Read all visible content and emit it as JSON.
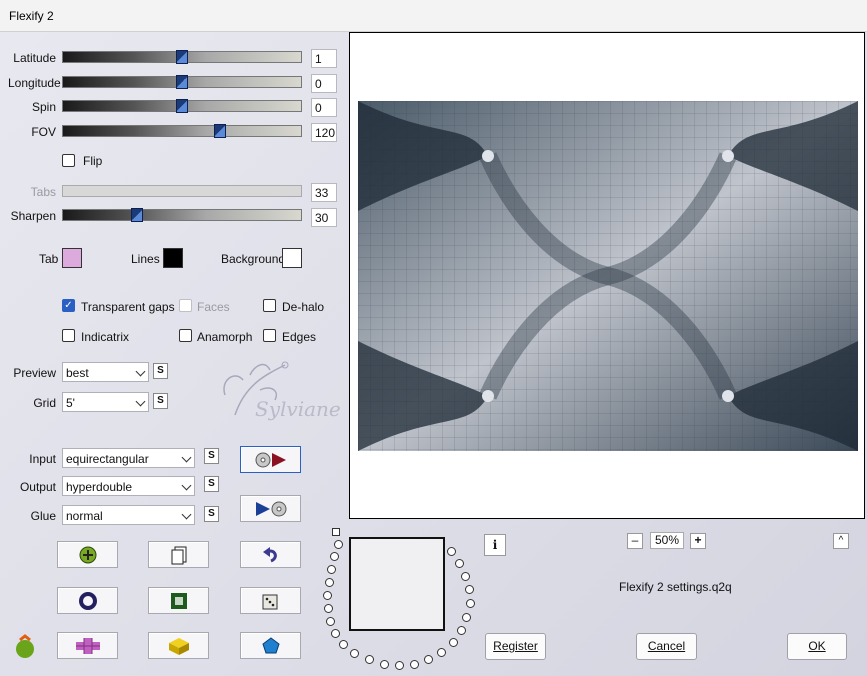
{
  "window": {
    "title": "Flexify 2"
  },
  "sliders": [
    {
      "label": "Latitude",
      "value": "1",
      "level": 0.5
    },
    {
      "label": "Longitude",
      "value": "0",
      "level": 0.5
    },
    {
      "label": "Spin",
      "value": "0",
      "level": 0.5
    },
    {
      "label": "FOV",
      "value": "120",
      "level": 0.66
    },
    {
      "label": "Tabs",
      "value": "33",
      "level": null,
      "disabled": true
    },
    {
      "label": "Sharpen",
      "value": "30",
      "level": 0.31
    }
  ],
  "flip": {
    "label": "Flip",
    "checked": false
  },
  "colors": {
    "tab_label": "Tab",
    "tab_color": "#dcaadc",
    "lines_label": "Lines",
    "lines_color": "#000000",
    "background_label": "Background",
    "background_color": "#ffffff"
  },
  "options": {
    "transparent_gaps": "Transparent gaps",
    "faces": "Faces",
    "de_halo": "De-halo",
    "indicatrix": "Indicatrix",
    "anamorph": "Anamorph",
    "edges": "Edges"
  },
  "selects": {
    "preview_label": "Preview",
    "preview_value": "best",
    "grid_label": "Grid",
    "grid_value": "5'",
    "input_label": "Input",
    "input_value": "equirectangular",
    "output_label": "Output",
    "output_value": "hyperdouble",
    "glue_label": "Glue",
    "glue_value": "normal",
    "s": "S"
  },
  "watermark": "Sylviane",
  "zoom": {
    "minus": "–",
    "value": "50%",
    "plus": "+"
  },
  "settings_file": "Flexify 2 settings.q2q",
  "buttons": {
    "info": "i",
    "collapse": "^",
    "register": "Register",
    "cancel": "Cancel",
    "ok": "OK"
  },
  "icons": [
    "input-play-icon",
    "output-play-icon",
    "randomize-icon",
    "copy-icon",
    "undo-icon",
    "ring-icon",
    "frame-icon",
    "dice-icon",
    "logo-icon",
    "cross-icon",
    "cube-icon",
    "gem-icon"
  ]
}
